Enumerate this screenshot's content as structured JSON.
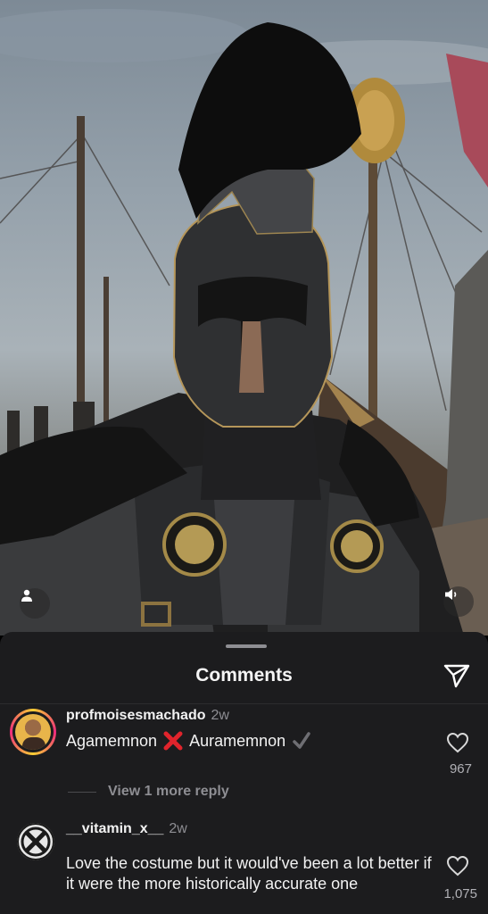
{
  "video": {
    "user_tag_icon": "person-icon",
    "sound_icon": "speaker-icon"
  },
  "sheet": {
    "title": "Comments",
    "share_icon": "paper-plane-icon"
  },
  "comments": [
    {
      "username": "profmoisesmachado",
      "time": "2w",
      "text_before": "Agamemnon",
      "emoji_1": "cross-mark",
      "text_after": "Auramemnon",
      "emoji_2": "check-mark",
      "likes": "967",
      "has_story_ring": true
    },
    {
      "username": "__vitamin_x__",
      "time": "2w",
      "text": "Love the costume but it would've been a lot better if it were the more historically accurate one",
      "likes": "1,075"
    }
  ],
  "replies": {
    "label": "View 1 more reply"
  },
  "colors": {
    "sheet_bg": "#1c1c1e",
    "accent_red": "#e0242c",
    "muted": "#8e8e93"
  }
}
